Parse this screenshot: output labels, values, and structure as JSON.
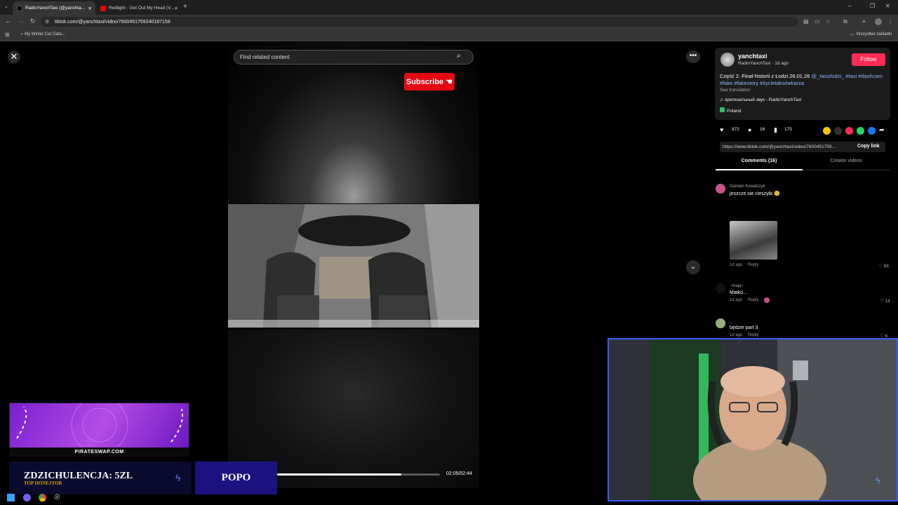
{
  "browser": {
    "tabs": [
      {
        "label": "RadioYanchTaxi (@yanchta..."
      },
      {
        "label": "Redlight - Get Out My Head (V..."
      }
    ],
    "url": "tiktok.com/@yanchtaxi/video/7600451759240187158",
    "bookmark_left": "My Winter Car Data...",
    "bookmark_right": "Wszystkie zakładki"
  },
  "video": {
    "search_placeholder": "Find related content",
    "subscribe_label": "Subscribe",
    "time": "02:05/02:44",
    "progress": 0.762
  },
  "post": {
    "username": "yanchtaxi",
    "subline": "RadioYanchTaxi · 1d ago",
    "follow_label": "Follow",
    "caption_text": "Część 2. Finał historii z Łodzi 26.01.26 ",
    "caption_tags": "@_taxizlodzi_ #taxi #dashcam #fake #fakestory #życietaksówkarza",
    "see_translation": "See translation",
    "sound": "оригинальный звук - RadioYanchTaxi",
    "location": "Poland",
    "likes": "872",
    "comments": "16",
    "saves": "175",
    "link": "https://www.tiktok.com/@yanchtaxi/video/7600451759...",
    "copy_link": "Copy link"
  },
  "tabs": {
    "comments": "Comments (16)",
    "creator": "Creator videos"
  },
  "comments": [
    {
      "name": "Damian Kowalczyk",
      "text": "jeszcze sie cieszyła 🙂",
      "meta": "1d ago",
      "reply": "Reply",
      "likes": "88"
    },
    {
      "name": "~maja~",
      "text": "Matko...",
      "meta": "1d ago",
      "reply": "Reply",
      "likes": "14"
    },
    {
      "name": "_",
      "text": "będzie part 3",
      "meta": "1d ago",
      "reply": "Reply",
      "likes": "6"
    }
  ],
  "overlay": {
    "ad_site": "PIRATESWAP.COM",
    "donor": "ZDZICHULENCJA: 5ZL",
    "donor_sub": "TOP DONEJTOR",
    "popo": "POPO"
  },
  "colors": {
    "follow": "#fe2c55",
    "subscribe": "#e50914",
    "tag": "#8fb7ff",
    "webcam_border": "#3b5bff"
  }
}
